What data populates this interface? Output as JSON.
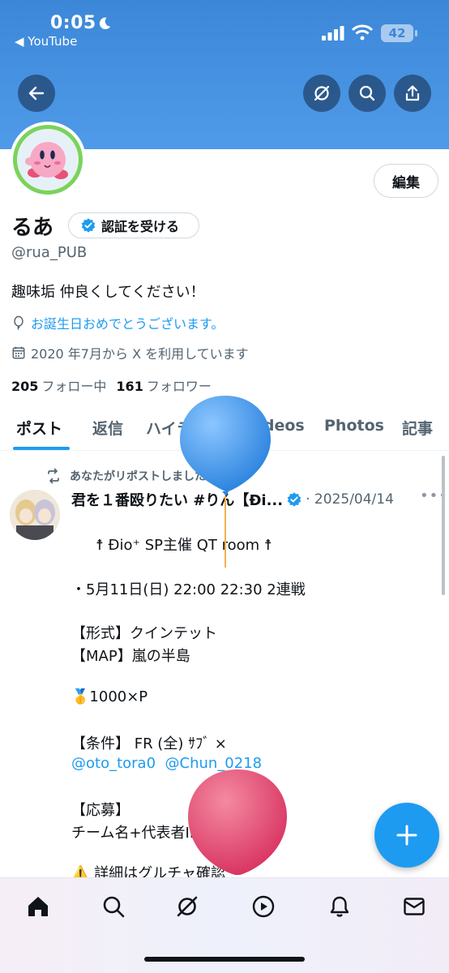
{
  "status_bar": {
    "time": "0:05",
    "back_app": "◀ YouTube",
    "battery": "42"
  },
  "colors": {
    "accent": "#1d9bf0",
    "banner": "#4a94e4",
    "text": "#0f1419",
    "secondary": "#536471"
  },
  "header_buttons": {
    "back_icon": "arrow-left-icon",
    "grok_icon": "grok-icon",
    "search_icon": "search-icon",
    "share_icon": "share-icon"
  },
  "profile": {
    "edit_label": "編集",
    "name": "るあ",
    "verify_label": "認証を受ける",
    "handle": "@rua_PUB",
    "bio": "趣味垢 仲良くしてください！",
    "birthday": "お誕生日おめでとうございます。",
    "joined": "2020 年7月から X を利用しています",
    "following_count": "205",
    "following_label": "フォロー中",
    "followers_count": "161",
    "followers_label": "フォロワー"
  },
  "tabs": [
    {
      "label": "ポスト",
      "active": true
    },
    {
      "label": "返信",
      "active": false
    },
    {
      "label": "ハイライト",
      "active": false
    },
    {
      "label": "Videos",
      "active": false
    },
    {
      "label": "Photos",
      "active": false
    },
    {
      "label": "記事",
      "active": false
    }
  ],
  "post": {
    "repost_label": "あなたがリポストしました",
    "author": "君を１番殴りたい #りん【Ði...",
    "date": "· 2025/04/14",
    "more": "•••",
    "lines": [
      "☨ Ðio⁺ SP主催  QT room ☨",
      "・5月11日(日)  22:00 22:30 2連戦",
      "【形式】クインテット",
      "【MAP】嵐の半島",
      "🥇1000×P",
      "【条件】  FR (全) ｻﾌﾞ ×",
      "【応募】",
      "チーム名+代表者ID@ｱﾘﾅｼ",
      "⚠️ 詳細はグルチャ確認"
    ],
    "mention_1": "@oto_tora0",
    "mention_2": "@Chun_0218"
  },
  "bottom_nav": [
    "home-icon",
    "search-icon",
    "grok-icon",
    "video-icon",
    "bell-icon",
    "mail-icon"
  ]
}
